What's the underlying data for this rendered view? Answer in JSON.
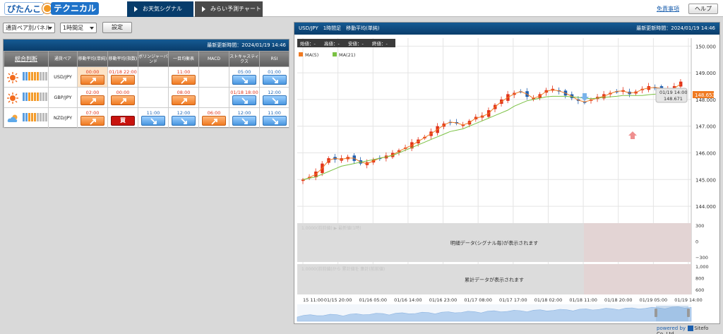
{
  "header": {
    "logo_text_1": "ぴたんこ",
    "logo_text_2": "テクニカル",
    "tabs": [
      {
        "label": "お天気シグナル",
        "active": true
      },
      {
        "label": "みらい予測チャート",
        "active": false
      }
    ],
    "disclaimer_link": "免責事項",
    "help_button": "ヘルプ"
  },
  "controls": {
    "panel_select": "通貨ペア別パネル",
    "timeframe_select": "1時間足",
    "settings_button": "設定"
  },
  "signal_panel": {
    "last_updated": "最新更新時間：2024/01/19 14:46",
    "columns": [
      "総合判断",
      "通貨ペア",
      "移動平均(単純)",
      "移動平均(指数)",
      "ボリンジャーバンド",
      "一目均衡表",
      "MACD",
      "ストキャスティクス",
      "RSI"
    ],
    "rows": [
      {
        "pair": "USD/JPY",
        "weather": "sunny",
        "level": 4,
        "signals": [
          {
            "time": "00:00",
            "type": "up",
            "time_color": "red",
            "highlight": true
          },
          {
            "time": "01/18 22:00",
            "type": "up",
            "time_color": "red",
            "highlight": false
          },
          {
            "time": "",
            "type": "none"
          },
          {
            "time": "11:00",
            "type": "up",
            "time_color": "red"
          },
          {
            "time": "",
            "type": "none"
          },
          {
            "time": "05:00",
            "type": "down",
            "time_color": "blue"
          },
          {
            "time": "01:00",
            "type": "down",
            "time_color": "blue"
          }
        ]
      },
      {
        "pair": "GBP/JPY",
        "weather": "sunny",
        "level": 4,
        "signals": [
          {
            "time": "02:00",
            "type": "up",
            "time_color": "red"
          },
          {
            "time": "00:00",
            "type": "up",
            "time_color": "red"
          },
          {
            "time": "",
            "type": "none"
          },
          {
            "time": "08:00",
            "type": "up",
            "time_color": "red"
          },
          {
            "time": "",
            "type": "none"
          },
          {
            "time": "01/18 18:00",
            "type": "down",
            "time_color": "red"
          },
          {
            "time": "12:00",
            "type": "down",
            "time_color": "blue"
          }
        ]
      },
      {
        "pair": "NZD/JPY",
        "weather": "cloudy",
        "level": 3,
        "signals": [
          {
            "time": "07:00",
            "type": "up",
            "time_color": "red"
          },
          {
            "time": "",
            "type": "buy",
            "label": "買"
          },
          {
            "time": "11:00",
            "type": "down",
            "time_color": "blue"
          },
          {
            "time": "12:00",
            "type": "down",
            "time_color": "blue"
          },
          {
            "time": "06:00",
            "type": "up",
            "time_color": "red"
          },
          {
            "time": "12:00",
            "type": "down",
            "time_color": "blue"
          },
          {
            "time": "11:00",
            "type": "down",
            "time_color": "blue"
          }
        ]
      }
    ]
  },
  "chart_panel": {
    "title": "USD/JPY　1時間足　移動平均(単純)",
    "last_updated": "最新更新時間：2024/01/19 14:46",
    "ohlc_labels": [
      "始値：-",
      "高値：-",
      "安値：-",
      "終値：-"
    ],
    "legend": [
      {
        "name": "MA(5)",
        "color": "#f07a21"
      },
      {
        "name": "MA(21)",
        "color": "#7ac143"
      }
    ],
    "price_ticks": [
      "150.000",
      "149.000",
      "148.000",
      "147.000",
      "146.000",
      "145.000",
      "144.000"
    ],
    "current_price": "148.653",
    "tooltip_time": "01/19 14:00",
    "tooltip_price": "148.671",
    "signal_pane_text": "明細データ(シグナル毎)が表示されます",
    "signal_pane_ticks": [
      "300",
      "0",
      "−300"
    ],
    "signal_pane_faded": "1.0000(前前値) ▶ 最新値(1時)",
    "cumulative_pane_text": "累計データが表示されます",
    "cumulative_pane_ticks": [
      "1,000",
      "800",
      "600"
    ],
    "cumulative_pane_faded": "1.0000(前前値)から 累計値を 集計(前前値)",
    "time_labels": [
      "15 11:00",
      "01/15 20:00",
      "01/16 05:00",
      "01/16 14:00",
      "01/16 23:00",
      "01/17 08:00",
      "01/17 17:00",
      "01/18 02:00",
      "01/18 11:00",
      "01/18 20:00",
      "01/19 05:00",
      "01/19 14:00"
    ]
  },
  "chart_data": {
    "type": "candlestick",
    "title": "USD/JPY 1時間足 移動平均(単純)",
    "x_range": [
      "01/15 11:00",
      "01/19 14:00"
    ],
    "ylim": [
      143.5,
      150.3
    ],
    "series": [
      {
        "name": "MA(5)",
        "color": "#f07a21"
      },
      {
        "name": "MA(21)",
        "color": "#7ac143"
      }
    ],
    "close_path": [
      145.0,
      145.1,
      145.3,
      145.6,
      145.8,
      145.75,
      145.8,
      145.85,
      145.7,
      145.6,
      145.65,
      145.75,
      145.8,
      145.9,
      146.0,
      146.1,
      146.2,
      146.4,
      146.5,
      146.6,
      146.8,
      147.0,
      147.1,
      147.15,
      147.1,
      147.05,
      147.2,
      147.35,
      147.4,
      147.6,
      147.8,
      148.0,
      148.2,
      148.25,
      148.3,
      148.1,
      148.05,
      148.2,
      148.35,
      148.4,
      148.3,
      148.15,
      148.05,
      147.95,
      147.9,
      148.0,
      148.1,
      148.2,
      148.25,
      148.3,
      148.35,
      148.2,
      148.3,
      148.4,
      148.5,
      148.45,
      148.35,
      148.4,
      148.5,
      148.67
    ],
    "ma21": [
      145.0,
      145.05,
      145.1,
      145.2,
      145.3,
      145.4,
      145.5,
      145.55,
      145.6,
      145.65,
      145.7,
      145.75,
      145.8,
      145.85,
      145.9,
      146.0,
      146.1,
      146.2,
      146.3,
      146.4,
      146.5,
      146.6,
      146.7,
      146.8,
      146.85,
      146.9,
      147.0,
      147.1,
      147.2,
      147.3,
      147.4,
      147.5,
      147.6,
      147.75,
      147.85,
      147.95,
      148.0,
      148.05,
      148.1,
      148.12,
      148.12,
      148.12,
      148.1,
      148.08,
      148.05,
      148.03,
      148.05,
      148.08,
      148.1,
      148.12,
      148.15,
      148.15,
      148.15,
      148.15,
      148.18,
      148.2,
      148.22,
      148.24,
      148.26,
      148.3
    ],
    "signal_markers": [
      {
        "type": "sell",
        "at": "01/18 09:00"
      },
      {
        "type": "buy",
        "at": "01/18 23:00"
      }
    ]
  }
}
